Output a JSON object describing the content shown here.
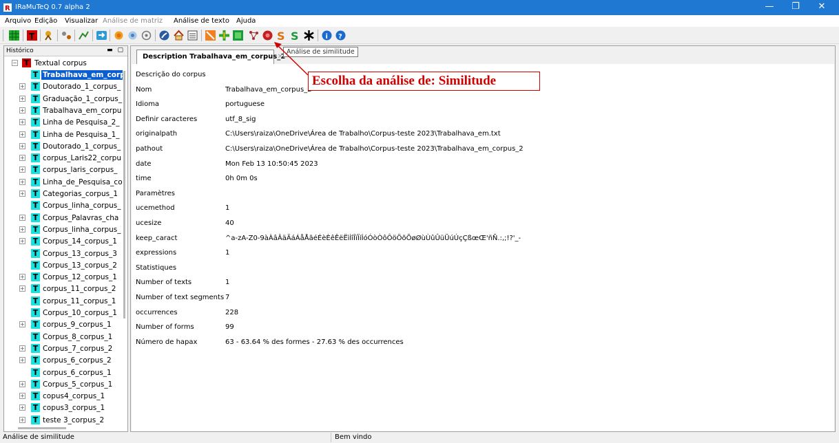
{
  "window": {
    "title": "IRaMuTeQ 0.7 alpha 2",
    "minimize": "—",
    "maximize": "❐",
    "close": "✕",
    "accent_color": "#1f78d1"
  },
  "menu": {
    "items": [
      {
        "label": "Arquivo",
        "enabled": true
      },
      {
        "label": "Edição",
        "enabled": true
      },
      {
        "label": "Visualizar",
        "enabled": true
      },
      {
        "label": "Análise de matriz",
        "enabled": false
      },
      {
        "label": "Análise de texto",
        "enabled": true
      },
      {
        "label": "Ajuda",
        "enabled": true
      }
    ]
  },
  "toolbar": {
    "buttons": [
      "matrix-icon",
      "text-icon",
      "analysis-icon",
      "stats-icon",
      "graph-icon",
      "import-icon",
      "circle-icon",
      "target-icon",
      "prototypical-icon",
      "compass-icon",
      "home-icon",
      "list-icon",
      "specificities-icon",
      "cross-icon",
      "similitude-icon",
      "graph2-icon",
      "cloud-icon",
      "s1-icon",
      "s2-icon",
      "asterisk-icon",
      "info-icon",
      "help-icon"
    ]
  },
  "history": {
    "label": "Histórico",
    "controls": "▬ ▢",
    "root": "Textual corpus",
    "items": [
      {
        "label": "Trabalhava_em_corp",
        "selected": true,
        "expandable": false
      },
      {
        "label": "Doutorado_1_corpus_",
        "expandable": true
      },
      {
        "label": "Graduação_1_corpus_",
        "expandable": true
      },
      {
        "label": "Trabalhava_em_corpu",
        "expandable": true
      },
      {
        "label": "Linha de Pesquisa_2_",
        "expandable": true
      },
      {
        "label": "Linha de Pesquisa_1_",
        "expandable": true
      },
      {
        "label": "Doutorado_1_corpus_",
        "expandable": true
      },
      {
        "label": "corpus_Laris22_corpu",
        "expandable": true
      },
      {
        "label": "corpus_laris_corpus_",
        "expandable": true
      },
      {
        "label": "Linha_de_Pesquisa_co",
        "expandable": true
      },
      {
        "label": "Categorias_corpus_1",
        "expandable": true
      },
      {
        "label": "Corpus_linha_corpus_",
        "expandable": false
      },
      {
        "label": "Corpus_Palavras_cha",
        "expandable": true
      },
      {
        "label": "Corpus_linha_corpus_",
        "expandable": true
      },
      {
        "label": "Corpus_14_corpus_1",
        "expandable": true
      },
      {
        "label": "Corpus_13_corpus_3",
        "expandable": false
      },
      {
        "label": "Corpus_13_corpus_2",
        "expandable": false
      },
      {
        "label": "Corpus_12_corpus_1",
        "expandable": true
      },
      {
        "label": "corpus_11_corpus_2",
        "expandable": true
      },
      {
        "label": "corpus_11_corpus_1",
        "expandable": false
      },
      {
        "label": "Corpus_10_corpus_1",
        "expandable": false
      },
      {
        "label": "corpus_9_corpus_1",
        "expandable": true
      },
      {
        "label": "Corpus_8_corpus_1",
        "expandable": false
      },
      {
        "label": "Corpus_7_corpus_2",
        "expandable": true
      },
      {
        "label": "corpus_6_corpus_2",
        "expandable": true
      },
      {
        "label": "corpus_6_corpus_1",
        "expandable": false
      },
      {
        "label": "Corpus_5_corpus_1",
        "expandable": true
      },
      {
        "label": "copus4_corpus_1",
        "expandable": true
      },
      {
        "label": "copus3_corpus_1",
        "expandable": true
      },
      {
        "label": "teste 3_corpus_2",
        "expandable": true
      }
    ]
  },
  "tab": {
    "label": "Description Trabalhava_em_corpus_2",
    "close": "✕"
  },
  "tooltip": "Análise de similitude",
  "annotation": "Escolha da análise de: Similitude",
  "details": [
    {
      "key": "Descrição do corpus",
      "value": ""
    },
    {
      "key": "Nom",
      "value": "Trabalhava_em_corpus_2"
    },
    {
      "key": "Idioma",
      "value": "portuguese"
    },
    {
      "key": "Definir caracteres",
      "value": "utf_8_sig"
    },
    {
      "key": "originalpath",
      "value": "C:\\Users\\raiza\\OneDrive\\Área de Trabalho\\Corpus-teste 2023\\Trabalhava_em.txt"
    },
    {
      "key": "pathout",
      "value": "C:\\Users\\raiza\\OneDrive\\Área de Trabalho\\Corpus-teste 2023\\Trabalhava_em_corpus_2"
    },
    {
      "key": "date",
      "value": "Mon Feb 13 10:50:45 2023"
    },
    {
      "key": "time",
      "value": "0h 0m 0s"
    },
    {
      "key": "Paramètres",
      "value": ""
    },
    {
      "key": "ucemethod",
      "value": "1"
    },
    {
      "key": "ucesize",
      "value": "40"
    },
    {
      "key": "keep_caract",
      "value": "^a-zA-Z0-9àÀâÂäÄáÁåÅãéÉèÈêÊëËìÌîÎïÏíÍóÓòÒôÔöÖõÕøØùÙûÛüÜúÚçÇßœŒ'ñÑ.:,;!?'_-"
    },
    {
      "key": "expressions",
      "value": "1"
    },
    {
      "key": "Statistiques",
      "value": ""
    },
    {
      "key": "Number of texts",
      "value": "1"
    },
    {
      "key": "Number of text segments",
      "value": "7"
    },
    {
      "key": "occurrences",
      "value": "228"
    },
    {
      "key": "Number of forms",
      "value": "99"
    },
    {
      "key": "Número de hapax",
      "value": "63 - 63.64 % des formes - 27.63 % des occurrences"
    }
  ],
  "status": {
    "left": "Análise de similitude",
    "right": "Bem vindo"
  }
}
